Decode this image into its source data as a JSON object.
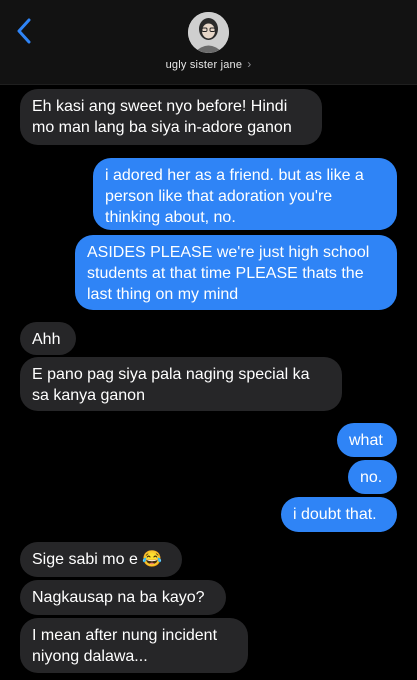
{
  "header": {
    "back_icon": "chevron-left-icon",
    "contact_name": "ugly sister jane",
    "contact_chevron": "›",
    "accent_color": "#2f84f6"
  },
  "messages": [
    {
      "dir": "in",
      "text": "Eh kasi ang sweet nyo before! Hindi mo man lang ba siya in-adore ganon"
    },
    {
      "dir": "out",
      "text": "i adored her as a friend. but as like a person like that adoration you're thinking about, no."
    },
    {
      "dir": "out",
      "text": "ASIDES PLEASE we're just high school students at that time PLEASE thats the last thing on my mind"
    },
    {
      "dir": "in",
      "text": "Ahh"
    },
    {
      "dir": "in",
      "text": "E pano pag siya pala naging special ka sa kanya ganon"
    },
    {
      "dir": "out",
      "text": "what"
    },
    {
      "dir": "out",
      "text": "no."
    },
    {
      "dir": "out",
      "text": "i doubt that."
    },
    {
      "dir": "in",
      "text": "Sige sabi mo e 😂"
    },
    {
      "dir": "in",
      "text": "Nagkausap na ba kayo?"
    },
    {
      "dir": "in",
      "text": "I mean after nung incident niyong dalawa..."
    }
  ]
}
